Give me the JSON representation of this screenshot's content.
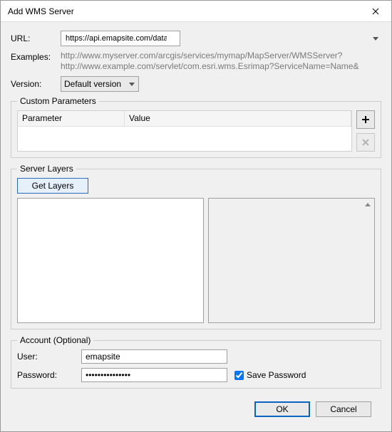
{
  "title": "Add WMS Server",
  "labels": {
    "url": "URL:",
    "examples": "Examples:",
    "version": "Version:",
    "user": "User:",
    "password": "Password:"
  },
  "url_value": "https://api.emapsite.com/dataservice.svc/api/WMS?Request=GetCapabilities&Service=",
  "examples_line1": "http://www.myserver.com/arcgis/services/mymap/MapServer/WMSServer?",
  "examples_line2": "http://www.example.com/servlet/com.esri.wms.Esrimap?ServiceName=Name&",
  "version_value": "Default version",
  "groups": {
    "custom_params": "Custom Parameters",
    "server_layers": "Server Layers",
    "account": "Account (Optional)"
  },
  "params_headers": {
    "parameter": "Parameter",
    "value": "Value"
  },
  "get_layers": "Get Layers",
  "user_value": "emapsite",
  "password_value": "•••••••••••••••",
  "save_password": "Save Password",
  "buttons": {
    "ok": "OK",
    "cancel": "Cancel"
  }
}
